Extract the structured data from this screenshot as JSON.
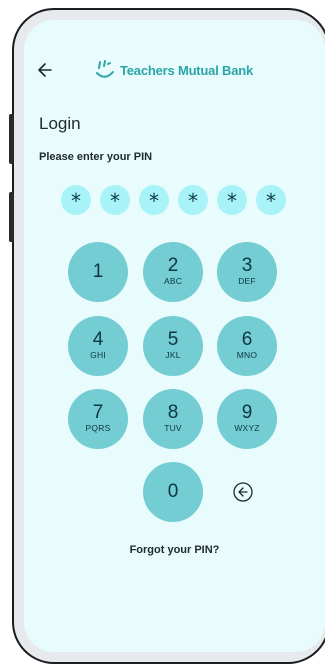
{
  "header": {
    "back_icon": "arrow-left-icon",
    "logo_icon": "smile-logo-icon",
    "brand_name": "Teachers Mutual Bank",
    "brand_color": "#2aa6a8"
  },
  "login": {
    "title": "Login",
    "pin_prompt": "Please enter your PIN",
    "pin_mask_char": "*",
    "pin_length": 6,
    "pin_dot_color": "#a8f3f7"
  },
  "keypad": {
    "key_color": "#73cdd2",
    "keys": [
      {
        "digit": "1",
        "letters": ""
      },
      {
        "digit": "2",
        "letters": "ABC"
      },
      {
        "digit": "3",
        "letters": "DEF"
      },
      {
        "digit": "4",
        "letters": "GHI"
      },
      {
        "digit": "5",
        "letters": "JKL"
      },
      {
        "digit": "6",
        "letters": "MNO"
      },
      {
        "digit": "7",
        "letters": "PQRS"
      },
      {
        "digit": "8",
        "letters": "TUV"
      },
      {
        "digit": "9",
        "letters": "WXYZ"
      },
      {
        "digit": "0",
        "letters": ""
      }
    ],
    "backspace_icon": "backspace-circle-arrow-icon"
  },
  "footer": {
    "forgot_pin": "Forgot your PIN?"
  },
  "colors": {
    "screen_background": "#e8fbfd",
    "text": "#1f2a2e"
  }
}
